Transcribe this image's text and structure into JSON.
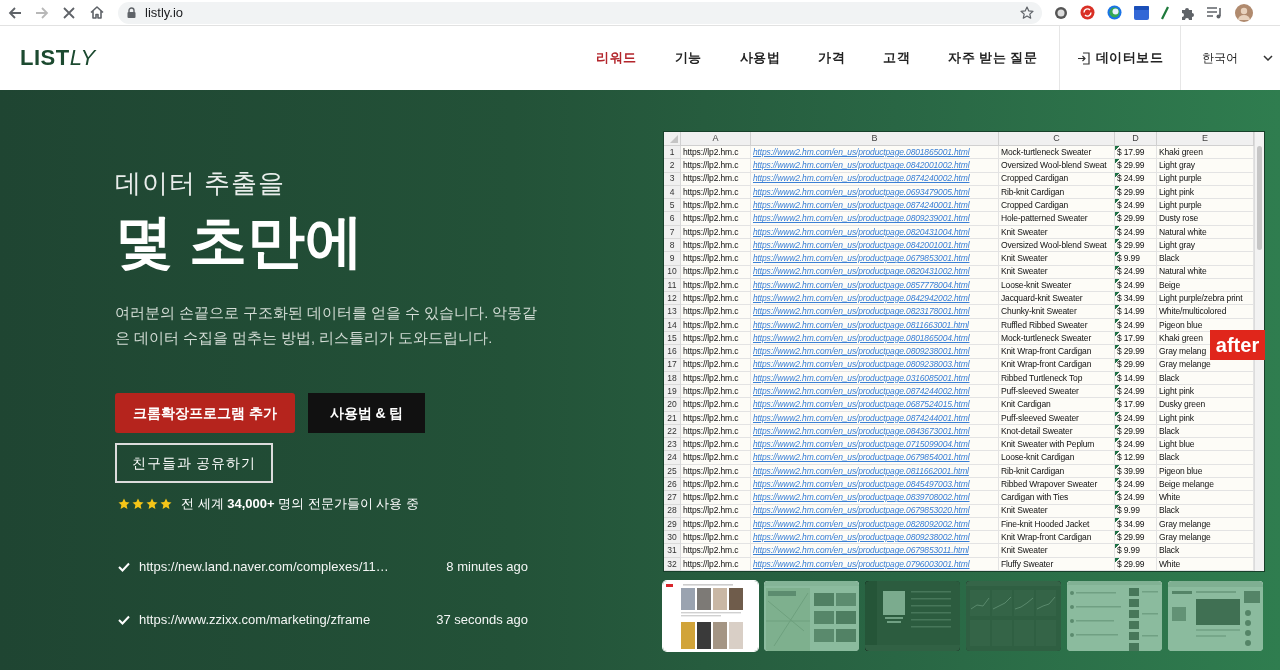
{
  "browser": {
    "url": "listly.io"
  },
  "nav": {
    "logo": {
      "part_1": "LIST",
      "part_2": "LY"
    },
    "items": [
      {
        "label": "리워드",
        "selected": true
      },
      {
        "label": "기능",
        "selected": false
      },
      {
        "label": "사용법",
        "selected": false
      },
      {
        "label": "가격",
        "selected": false
      },
      {
        "label": "고객",
        "selected": false
      },
      {
        "label": "자주 받는 질문",
        "selected": false
      }
    ],
    "dashboard_link": "데이터보드",
    "language": "한국어"
  },
  "hero": {
    "subtitle": "데이터 추출을",
    "title": "몇 초만에",
    "description": "여러분의 손끝으로 구조화된 데이터를 얻을 수 있습니다. 악몽같은 데이터 수집을 멈추는 방법, 리스틀리가 도와드립니다.",
    "buttons": [
      {
        "label": "크롬확장프로그램 추가",
        "kind": "primary"
      },
      {
        "label": "사용법 & 팁",
        "kind": "dark"
      },
      {
        "label": "친구들과 공유하기",
        "kind": "outline"
      }
    ],
    "rating": {
      "stars": 4,
      "text": "전 세계 **34,000+** 명의 전문가들이 사용 중"
    },
    "recent_extractions": [
      {
        "url": "https://new.land.naver.com/complexes/11…",
        "time": "8 minutes ago"
      },
      {
        "url": "https://www.zzixx.com/marketing/zframe",
        "time": "37 seconds ago"
      }
    ]
  },
  "preview": {
    "badge": "after",
    "spreadsheet": {
      "columns": [
        {
          "label": "A",
          "kind": "text"
        },
        {
          "label": "B",
          "kind": "link"
        },
        {
          "label": "C",
          "kind": "text"
        },
        {
          "label": "D",
          "kind": "number"
        },
        {
          "label": "E",
          "kind": "text"
        }
      ],
      "rows": [
        {
          "number": "1",
          "cells": [
            "https://lp2.hm.c",
            "https://www2.hm.com/en_us/productpage.0801865001.html",
            "Mock-turtleneck Sweater",
            "$ 17.99",
            "Khaki green"
          ]
        },
        {
          "number": "2",
          "cells": [
            "https://lp2.hm.c",
            "https://www2.hm.com/en_us/productpage.0842001002.html",
            "Oversized Wool-blend Sweat",
            "$ 29.99",
            "Light gray"
          ]
        },
        {
          "number": "3",
          "cells": [
            "https://lp2.hm.c",
            "https://www2.hm.com/en_us/productpage.0874240002.html",
            "Cropped Cardigan",
            "$ 24.99",
            "Light purple"
          ]
        },
        {
          "number": "4",
          "cells": [
            "https://lp2.hm.c",
            "https://www2.hm.com/en_us/productpage.0693479005.html",
            "Rib-knit Cardigan",
            "$ 29.99",
            "Light pink"
          ]
        },
        {
          "number": "5",
          "cells": [
            "https://lp2.hm.c",
            "https://www2.hm.com/en_us/productpage.0874240001.html",
            "Cropped Cardigan",
            "$ 24.99",
            "Light purple"
          ]
        },
        {
          "number": "6",
          "cells": [
            "https://lp2.hm.c",
            "https://www2.hm.com/en_us/productpage.0809239001.html",
            "Hole-patterned Sweater",
            "$ 29.99",
            "Dusty rose"
          ]
        },
        {
          "number": "7",
          "cells": [
            "https://lp2.hm.c",
            "https://www2.hm.com/en_us/productpage.0820431004.html",
            "Knit Sweater",
            "$ 24.99",
            "Natural white"
          ]
        },
        {
          "number": "8",
          "cells": [
            "https://lp2.hm.c",
            "https://www2.hm.com/en_us/productpage.0842001001.html",
            "Oversized Wool-blend Sweat",
            "$ 29.99",
            "Light gray"
          ]
        },
        {
          "number": "9",
          "cells": [
            "https://lp2.hm.c",
            "https://www2.hm.com/en_us/productpage.0679853001.html",
            "Knit Sweater",
            "$ 9.99",
            "Black"
          ]
        },
        {
          "number": "10",
          "cells": [
            "https://lp2.hm.c",
            "https://www2.hm.com/en_us/productpage.0820431002.html",
            "Knit Sweater",
            "$ 24.99",
            "Natural white"
          ]
        },
        {
          "number": "11",
          "cells": [
            "https://lp2.hm.c",
            "https://www2.hm.com/en_us/productpage.0857778004.html",
            "Loose-knit Sweater",
            "$ 24.99",
            "Beige"
          ]
        },
        {
          "number": "12",
          "cells": [
            "https://lp2.hm.c",
            "https://www2.hm.com/en_us/productpage.0842942002.html",
            "Jacquard-knit Sweater",
            "$ 34.99",
            "Light purple/zebra print"
          ]
        },
        {
          "number": "13",
          "cells": [
            "https://lp2.hm.c",
            "https://www2.hm.com/en_us/productpage.0823178001.html",
            "Chunky-knit Sweater",
            "$ 14.99",
            "White/multicolored"
          ]
        },
        {
          "number": "14",
          "cells": [
            "https://lp2.hm.c",
            "https://www2.hm.com/en_us/productpage.0811663001.html",
            "Ruffled Ribbed Sweater",
            "$ 24.99",
            "Pigeon blue"
          ]
        },
        {
          "number": "15",
          "cells": [
            "https://lp2.hm.c",
            "https://www2.hm.com/en_us/productpage.0801865004.html",
            "Mock-turtleneck Sweater",
            "$ 17.99",
            "Khaki green"
          ]
        },
        {
          "number": "16",
          "cells": [
            "https://lp2.hm.c",
            "https://www2.hm.com/en_us/productpage.0809238001.html",
            "Knit Wrap-front Cardigan",
            "$ 29.99",
            "Gray melang"
          ]
        },
        {
          "number": "17",
          "cells": [
            "https://lp2.hm.c",
            "https://www2.hm.com/en_us/productpage.0809238003.html",
            "Knit Wrap-front Cardigan",
            "$ 29.99",
            "Gray melange"
          ]
        },
        {
          "number": "18",
          "cells": [
            "https://lp2.hm.c",
            "https://www2.hm.com/en_us/productpage.0316085001.html",
            "Ribbed Turtleneck Top",
            "$ 14.99",
            "Black"
          ]
        },
        {
          "number": "19",
          "cells": [
            "https://lp2.hm.c",
            "https://www2.hm.com/en_us/productpage.0874244002.html",
            "Puff-sleeved Sweater",
            "$ 24.99",
            "Light pink"
          ]
        },
        {
          "number": "20",
          "cells": [
            "https://lp2.hm.c",
            "https://www2.hm.com/en_us/productpage.0687524015.html",
            "Knit Cardigan",
            "$ 17.99",
            "Dusky green"
          ]
        },
        {
          "number": "21",
          "cells": [
            "https://lp2.hm.c",
            "https://www2.hm.com/en_us/productpage.0874244001.html",
            "Puff-sleeved Sweater",
            "$ 24.99",
            "Light pink"
          ]
        },
        {
          "number": "22",
          "cells": [
            "https://lp2.hm.c",
            "https://www2.hm.com/en_us/productpage.0843673001.html",
            "Knot-detail Sweater",
            "$ 29.99",
            "Black"
          ]
        },
        {
          "number": "23",
          "cells": [
            "https://lp2.hm.c",
            "https://www2.hm.com/en_us/productpage.0715099004.html",
            "Knit Sweater with Peplum",
            "$ 24.99",
            "Light blue"
          ]
        },
        {
          "number": "24",
          "cells": [
            "https://lp2.hm.c",
            "https://www2.hm.com/en_us/productpage.0679854001.html",
            "Loose-knit Cardigan",
            "$ 12.99",
            "Black"
          ]
        },
        {
          "number": "25",
          "cells": [
            "https://lp2.hm.c",
            "https://www2.hm.com/en_us/productpage.0811662001.html",
            "Rib-knit Cardigan",
            "$ 39.99",
            "Pigeon blue"
          ]
        },
        {
          "number": "26",
          "cells": [
            "https://lp2.hm.c",
            "https://www2.hm.com/en_us/productpage.0845497003.html",
            "Ribbed Wrapover Sweater",
            "$ 24.99",
            "Beige melange"
          ]
        },
        {
          "number": "27",
          "cells": [
            "https://lp2.hm.c",
            "https://www2.hm.com/en_us/productpage.0839708002.html",
            "Cardigan with Ties",
            "$ 24.99",
            "White"
          ]
        },
        {
          "number": "28",
          "cells": [
            "https://lp2.hm.c",
            "https://www2.hm.com/en_us/productpage.0679853020.html",
            "Knit Sweater",
            "$ 9.99",
            "Black"
          ]
        },
        {
          "number": "29",
          "cells": [
            "https://lp2.hm.c",
            "https://www2.hm.com/en_us/productpage.0828092002.html",
            "Fine-knit Hooded Jacket",
            "$ 34.99",
            "Gray melange"
          ]
        },
        {
          "number": "30",
          "cells": [
            "https://lp2.hm.c",
            "https://www2.hm.com/en_us/productpage.0809238002.html",
            "Knit Wrap-front Cardigan",
            "$ 29.99",
            "Gray melange"
          ]
        },
        {
          "number": "31",
          "cells": [
            "https://lp2.hm.c",
            "https://www2.hm.com/en_us/productpage.0679853011.html",
            "Knit Sweater",
            "$ 9.99",
            "Black"
          ]
        },
        {
          "number": "32",
          "cells": [
            "https://lp2.hm.c",
            "https://www2.hm.com/en_us/productpage.0796003001.html",
            "Fluffy Sweater",
            "$ 29.99",
            "White"
          ]
        }
      ]
    },
    "thumbnails": [
      {
        "kind": "product-grid",
        "selected": true
      },
      {
        "kind": "map-listing",
        "selected": false
      },
      {
        "kind": "music-app",
        "selected": false
      },
      {
        "kind": "dashboard",
        "selected": false
      },
      {
        "kind": "feed",
        "selected": false
      },
      {
        "kind": "social-profile",
        "selected": false
      }
    ]
  }
}
